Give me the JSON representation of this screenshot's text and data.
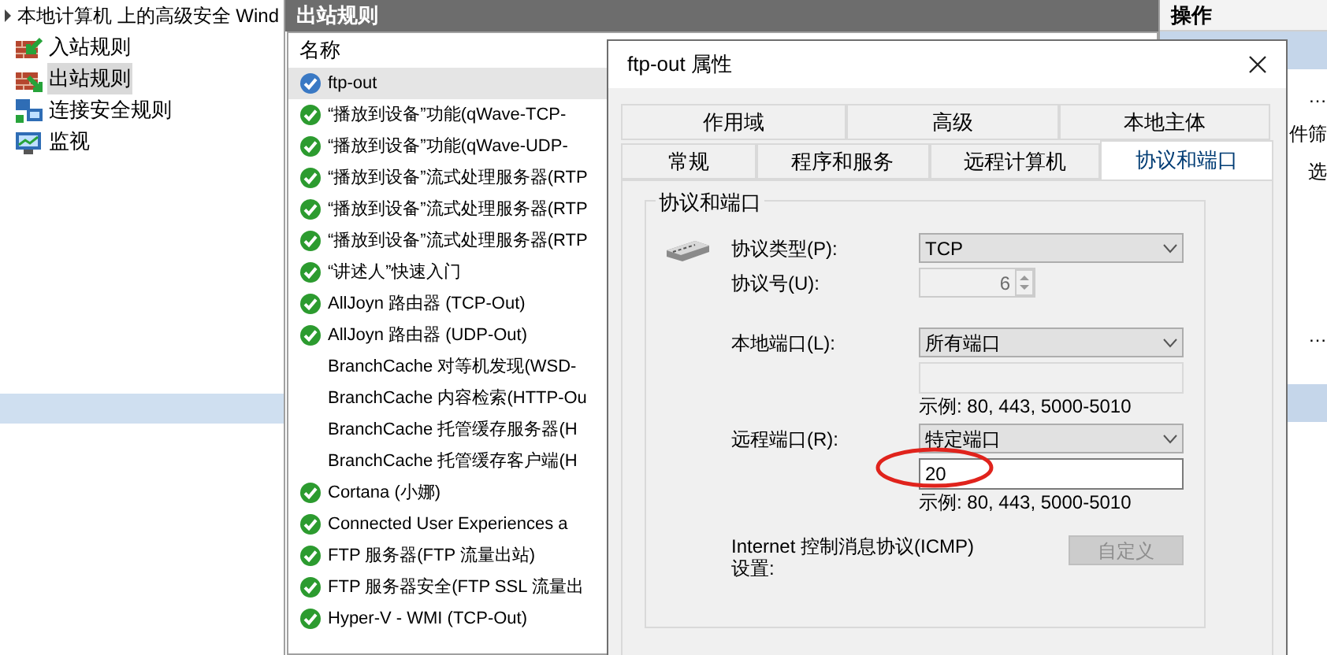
{
  "console_title": "本地计算机 上的高级安全 Wind",
  "tree": [
    {
      "label": "入站规则",
      "kind": "inbound",
      "selected": false
    },
    {
      "label": "出站规则",
      "kind": "outbound",
      "selected": true
    },
    {
      "label": "连接安全规则",
      "kind": "connection",
      "selected": false
    },
    {
      "label": "监视",
      "kind": "monitor",
      "selected": false
    }
  ],
  "rules_panel": {
    "title": "出站规则",
    "column": "名称",
    "rows": [
      {
        "name": "ftp-out",
        "enabled": true,
        "selected": true
      },
      {
        "name": "“播放到设备”功能(qWave-TCP-",
        "enabled": true,
        "selected": false
      },
      {
        "name": "“播放到设备”功能(qWave-UDP-",
        "enabled": true,
        "selected": false
      },
      {
        "name": "“播放到设备”流式处理服务器(RTP",
        "enabled": true,
        "selected": false
      },
      {
        "name": "“播放到设备”流式处理服务器(RTP",
        "enabled": true,
        "selected": false
      },
      {
        "name": "“播放到设备”流式处理服务器(RTP",
        "enabled": true,
        "selected": false
      },
      {
        "name": "“讲述人”快速入门",
        "enabled": true,
        "selected": false
      },
      {
        "name": "AllJoyn 路由器 (TCP-Out)",
        "enabled": true,
        "selected": false
      },
      {
        "name": "AllJoyn 路由器 (UDP-Out)",
        "enabled": true,
        "selected": false
      },
      {
        "name": "BranchCache 对等机发现(WSD-",
        "enabled": false,
        "selected": false
      },
      {
        "name": "BranchCache 内容检索(HTTP-Ou",
        "enabled": false,
        "selected": false
      },
      {
        "name": "BranchCache 托管缓存服务器(H",
        "enabled": false,
        "selected": false
      },
      {
        "name": "BranchCache 托管缓存客户端(H",
        "enabled": false,
        "selected": false
      },
      {
        "name": "Cortana (小娜)",
        "enabled": true,
        "selected": false
      },
      {
        "name": "Connected User Experiences a",
        "enabled": true,
        "selected": false
      },
      {
        "name": "FTP 服务器(FTP 流量出站)",
        "enabled": true,
        "selected": false
      },
      {
        "name": "FTP 服务器安全(FTP SSL 流量出",
        "enabled": true,
        "selected": false
      },
      {
        "name": "Hyper-V - WMI (TCP-Out)",
        "enabled": true,
        "selected": false
      }
    ]
  },
  "actions_panel": {
    "title": "操作",
    "items": [
      "…",
      "件筛",
      "选",
      "…"
    ]
  },
  "dialog": {
    "title": "ftp-out 属性",
    "tab_rows": [
      [
        {
          "label": "作用域",
          "selected": false
        },
        {
          "label": "高级",
          "selected": false
        },
        {
          "label": "本地主体",
          "selected": false
        }
      ],
      [
        {
          "label": "常规",
          "selected": false
        },
        {
          "label": "程序和服务",
          "selected": false
        },
        {
          "label": "远程计算机",
          "selected": false
        },
        {
          "label": "协议和端口",
          "selected": true
        }
      ]
    ],
    "group_title": "协议和端口",
    "protocol_type": {
      "label": "协议类型(P):",
      "value": "TCP"
    },
    "protocol_number": {
      "label": "协议号(U):",
      "value": "6",
      "disabled": true
    },
    "local_port": {
      "label": "本地端口(L):",
      "value": "所有端口"
    },
    "local_port_list": {
      "disabled": true,
      "hint": "示例: 80, 443, 5000-5010"
    },
    "remote_port": {
      "label": "远程端口(R):",
      "value": "特定端口"
    },
    "remote_port_list": {
      "value": "20",
      "disabled": false,
      "hint": "示例: 80, 443, 5000-5010"
    },
    "icmp": {
      "label": "Internet 控制消息协议(ICMP)设置:",
      "button": "自定义",
      "button_disabled": true
    }
  }
}
